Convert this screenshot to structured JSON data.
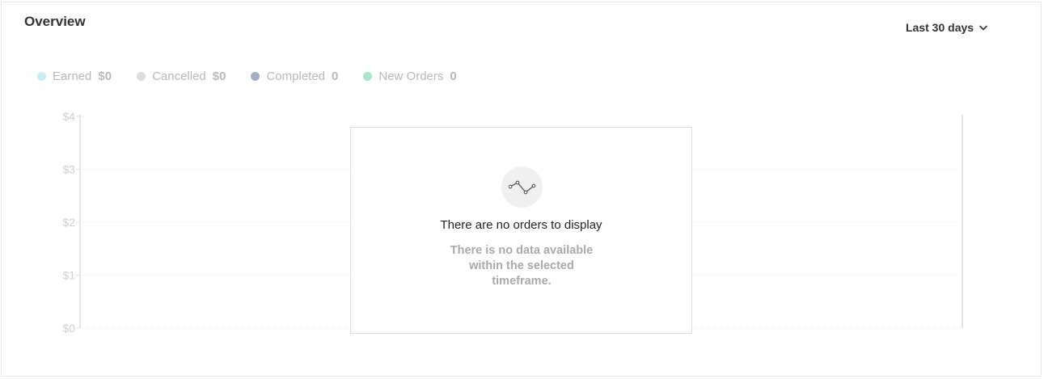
{
  "header": {
    "title": "Overview",
    "range_label": "Last 30 days"
  },
  "legend": [
    {
      "label": "Earned",
      "value": "$0",
      "color": "#c7eef5"
    },
    {
      "label": "Cancelled",
      "value": "$0",
      "color": "#dddddd"
    },
    {
      "label": "Completed",
      "value": "0",
      "color": "#a2aec6"
    },
    {
      "label": "New Orders",
      "value": "0",
      "color": "#a6e5c7"
    }
  ],
  "empty_state": {
    "icon": "line-chart-icon",
    "title": "There are no orders to display",
    "subtitle": "There is no data available within the selected timeframe."
  },
  "chart_data": {
    "type": "line",
    "title": "",
    "xlabel": "",
    "ylabel": "",
    "ylim": [
      0,
      4
    ],
    "y_ticks": [
      "$0",
      "$1",
      "$2",
      "$3",
      "$4"
    ],
    "series": [],
    "grid": true
  }
}
